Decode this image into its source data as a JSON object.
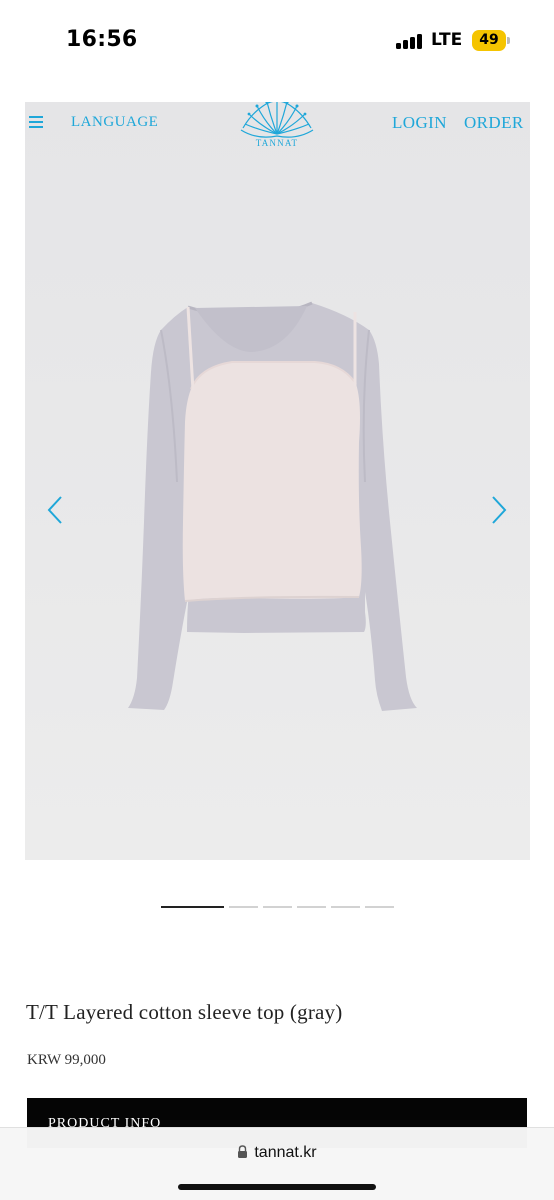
{
  "status_bar": {
    "time": "16:56",
    "carrier": "LTE",
    "battery_percent": "49",
    "signal_icon": "signal-bars-icon",
    "battery_color": "#f5c400"
  },
  "header": {
    "menu_icon": "hamburger-menu-icon",
    "language_label": "LANGUAGE",
    "logo_text": "TANNAT",
    "login_label": "LOGIN",
    "order_label": "ORDER",
    "accent_color": "#1fa7d9"
  },
  "carousel": {
    "prev_icon": "chevron-left-icon",
    "next_icon": "chevron-right-icon",
    "total_slides": 6,
    "active_slide": 1
  },
  "product": {
    "title": "T/T Layered cotton sleeve top (gray)",
    "price": "KRW 99,000",
    "info_label": "PRODUCT INFO"
  },
  "browser": {
    "lock_icon": "lock-icon",
    "url": "tannat.kr"
  }
}
